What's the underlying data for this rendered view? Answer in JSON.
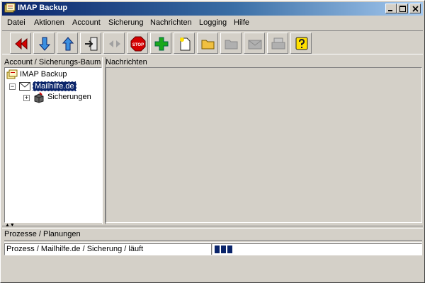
{
  "window": {
    "title": "IMAP Backup",
    "controls": [
      "minimize-icon",
      "maximize-icon",
      "close-icon"
    ]
  },
  "menu": [
    {
      "label": "Datei"
    },
    {
      "label": "Aktionen"
    },
    {
      "label": "Account"
    },
    {
      "label": "Sicherung"
    },
    {
      "label": "Nachrichten"
    },
    {
      "label": "Logging"
    },
    {
      "label": "Hilfe"
    }
  ],
  "toolbar": {
    "buttons": [
      {
        "icon": "back-red-icon",
        "enabled": true
      },
      {
        "icon": "arrow-down-icon",
        "enabled": true
      },
      {
        "icon": "arrow-up-icon",
        "enabled": true
      },
      {
        "icon": "exit-door-icon",
        "enabled": true
      },
      {
        "icon": "swap-arrows-icon",
        "enabled": false
      },
      {
        "icon": "stop-sign-icon",
        "enabled": true,
        "label": "STOP"
      },
      {
        "icon": "plus-icon",
        "enabled": true
      },
      {
        "icon": "new-document-icon",
        "enabled": true
      },
      {
        "icon": "folder-open-icon",
        "enabled": true
      },
      {
        "icon": "folder-disabled-icon",
        "enabled": false
      },
      {
        "icon": "mail-disabled-icon",
        "enabled": false
      },
      {
        "icon": "printer-disabled-icon",
        "enabled": false
      },
      {
        "icon": "help-icon",
        "enabled": true
      }
    ]
  },
  "tree_pane": {
    "header": "Account / Sicherungs-Baum",
    "nodes": [
      {
        "label": "IMAP Backup",
        "icon": "imap-root-icon"
      },
      {
        "label": "Mailhilfe.de",
        "icon": "mail-envelope-icon",
        "selected": true
      },
      {
        "label": "Sicherungen",
        "icon": "backup-box-icon"
      }
    ]
  },
  "messages_pane": {
    "header": "Nachrichten"
  },
  "processes": {
    "header": "Prozesse / Planungen",
    "row_text": "Prozess / Mailhilfe.de / Sicherung / läuft",
    "progress_blocks": 3
  },
  "colors": {
    "titlebar_start": "#0a246a",
    "titlebar_end": "#a6caf0",
    "face": "#d4d0c8",
    "selection": "#0a246a"
  }
}
